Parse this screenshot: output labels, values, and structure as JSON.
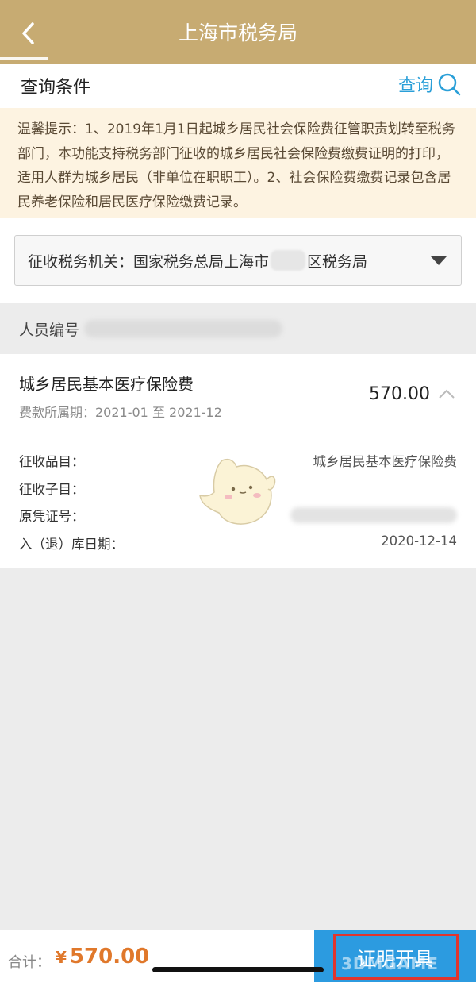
{
  "header": {
    "title": "上海市税务局"
  },
  "query": {
    "title": "查询条件",
    "button_label": "查询"
  },
  "notice": {
    "text": "温馨提示：1、2019年1月1日起城乡居民社会保险费征管职责划转至税务部门，本功能支持税务部门征收的城乡居民社会保险费缴费证明的打印，适用人群为城乡居民（非单位在职职工）。2、社会保险费缴费记录包含居民养老保险和居民医疗保险缴费记录。"
  },
  "tax_office": {
    "prefix": "征收税务机关：国家税务总局上海市",
    "suffix": "区税务局"
  },
  "person": {
    "label": "人员编号"
  },
  "record": {
    "title": "城乡居民基本医疗保险费",
    "period_label": "费款所属期：2021-01 至 2021-12",
    "amount": "570.00",
    "details": [
      {
        "key": "征收品目：",
        "value": "城乡居民基本医疗保险费"
      },
      {
        "key": "征收子目：",
        "value": ""
      },
      {
        "key": "原凭证号：",
        "value": ""
      },
      {
        "key": "入（退）库日期：",
        "value": "2020-12-14"
      }
    ]
  },
  "footer": {
    "total_label": "合计：",
    "currency": "¥",
    "total_amount": "570.00",
    "issue_button": "证明开具"
  },
  "watermark": "3DMGAME",
  "colors": {
    "header_bg": "#c7ab72",
    "accent_blue": "#2c9be0",
    "amount_orange": "#e0782b",
    "notice_bg": "#fdf3e1",
    "highlight_red": "#e0352d"
  }
}
